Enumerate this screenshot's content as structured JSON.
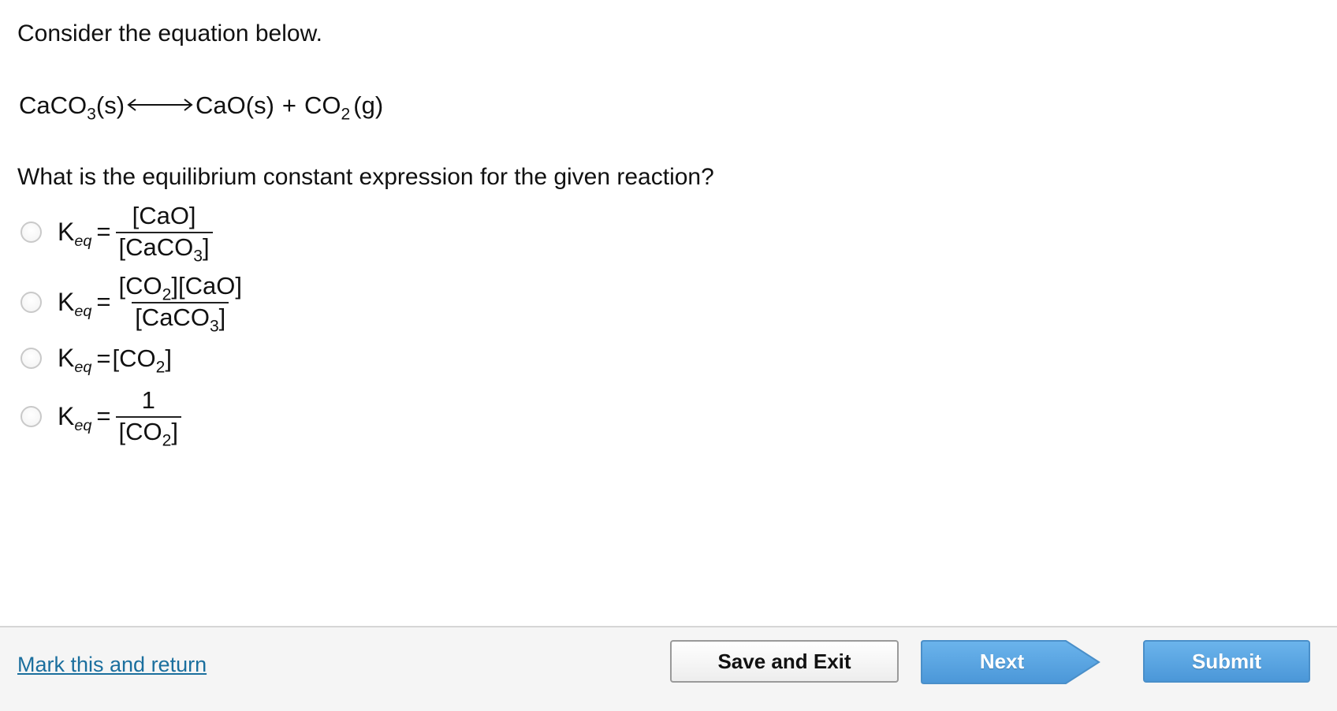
{
  "question": {
    "prompt": "Consider the equation below.",
    "equation": {
      "reactant": "CaCO",
      "reactant_sub": "3",
      "reactant_state": "(s)",
      "product1": "CaO(s)",
      "plus": "+",
      "product2": "CO",
      "product2_sub": "2",
      "product2_state": "(g)",
      "arrow_icon": "double-headed-arrow-icon"
    },
    "ask": "What is the equilibrium constant expression for the given reaction?"
  },
  "options": [
    {
      "k": "K",
      "k_sub": "eq",
      "equals": "=",
      "num": "[CaO]",
      "den_a": "[CaCO",
      "den_sub": "3",
      "den_b": "]"
    },
    {
      "k": "K",
      "k_sub": "eq",
      "equals": "=",
      "num_a": "[CO",
      "num_sub": "2",
      "num_b": "][CaO]",
      "den_a": "[CaCO",
      "den_sub": "3",
      "den_b": "]"
    },
    {
      "k": "K",
      "k_sub": "eq",
      "equals": "=",
      "rhs_a": "[CO",
      "rhs_sub": "2",
      "rhs_b": "]"
    },
    {
      "k": "K",
      "k_sub": "eq",
      "equals": "=",
      "num": "1",
      "den_a": "[CO",
      "den_sub": "2",
      "den_b": "]"
    }
  ],
  "footer": {
    "mark_link": "Mark this and return",
    "save_label": "Save and Exit",
    "next_label": "Next",
    "submit_label": "Submit"
  },
  "colors": {
    "link": "#1b6f9e",
    "primary_button": "#5aa6e3",
    "footer_bg": "#f5f5f5"
  }
}
